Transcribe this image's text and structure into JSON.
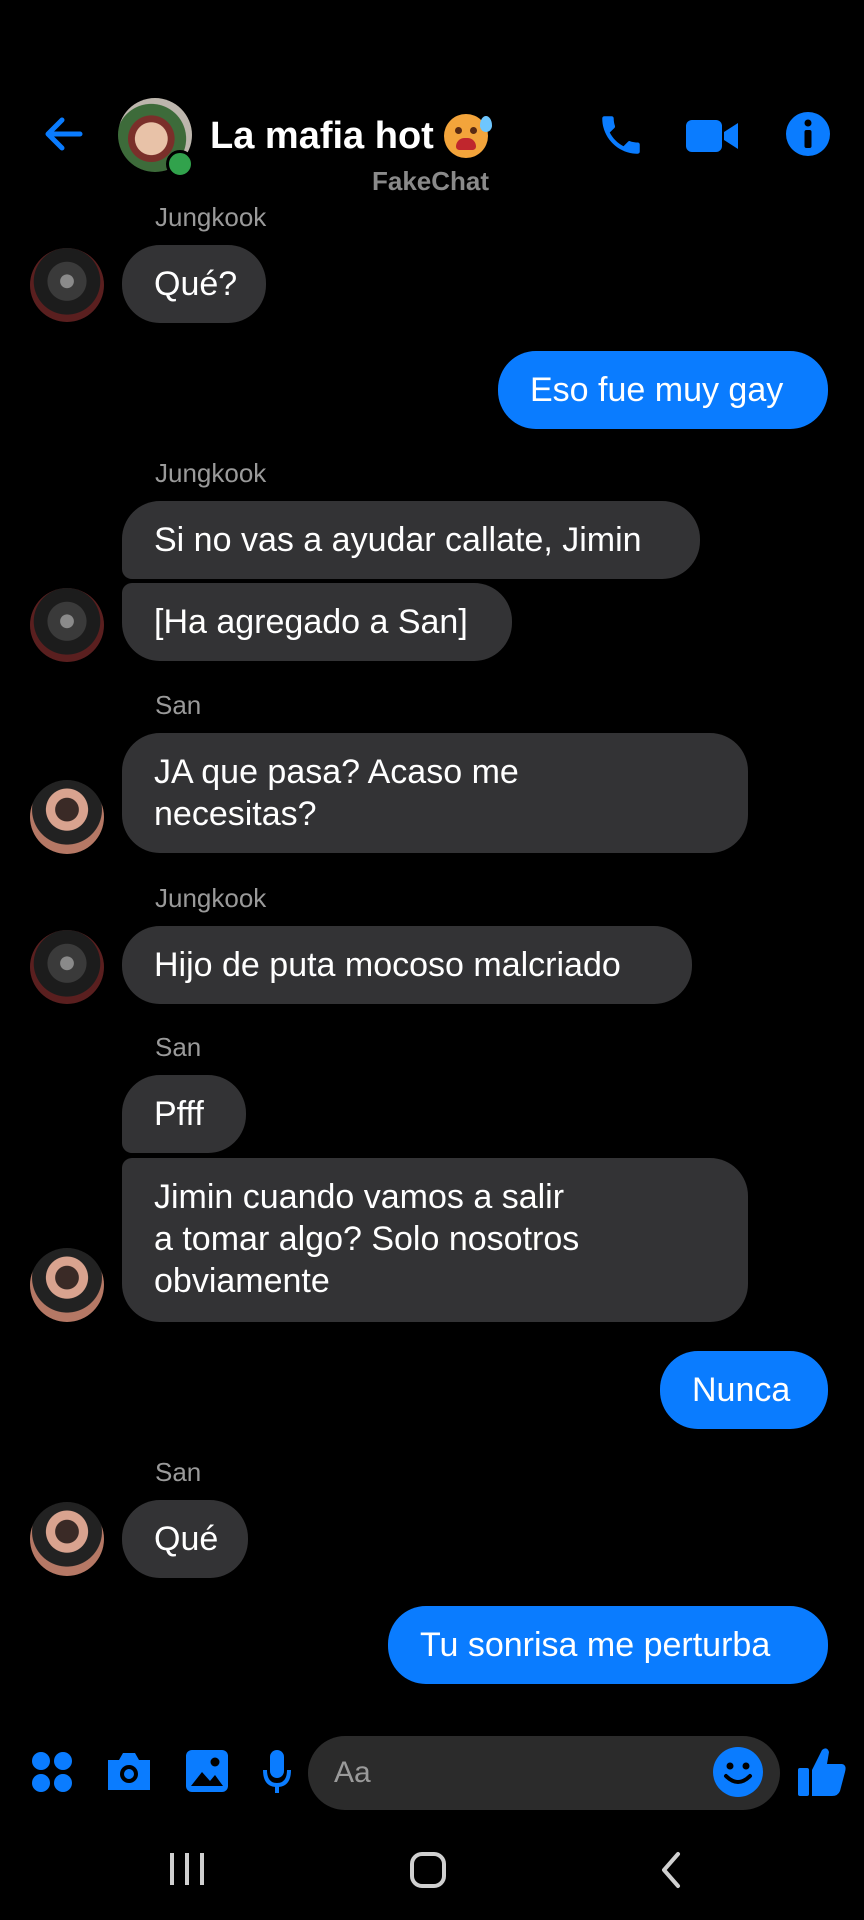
{
  "header": {
    "title": "La mafia hot",
    "watermark": "FakeChat",
    "accent": "#0a7cff",
    "icons": [
      "back-arrow-icon",
      "phone-icon",
      "video-camera-icon",
      "info-icon"
    ]
  },
  "messages": [
    {
      "sender": "Jungkook",
      "text": "Qué?"
    },
    {
      "sender": "me",
      "text": "Eso fue muy gay"
    },
    {
      "sender": "Jungkook",
      "text": "Si no vas a ayudar callate, Jimin"
    },
    {
      "sender": "Jungkook",
      "text": "[Ha agregado a San]"
    },
    {
      "sender": "San",
      "text": "JA que pasa? Acaso me\nnecesitas?"
    },
    {
      "sender": "Jungkook",
      "text": "Hijo de puta mocoso malcriado"
    },
    {
      "sender": "San",
      "text": "Pfff"
    },
    {
      "sender": "San",
      "text": "Jimin cuando vamos a salir\na tomar algo? Solo nosotros\nobviamente"
    },
    {
      "sender": "me",
      "text": "Nunca"
    },
    {
      "sender": "San",
      "text": "Qué"
    },
    {
      "sender": "me",
      "text": "Tu sonrisa me perturba"
    }
  ],
  "sender_labels": {
    "jungkook": "Jungkook",
    "san": "San"
  },
  "composer": {
    "placeholder": "Aa",
    "icons": [
      "apps-grid-icon",
      "camera-icon",
      "gallery-icon",
      "microphone-icon",
      "emoji-icon",
      "like-thumb-icon"
    ]
  },
  "colors": {
    "bubble_other": "#333335",
    "bubble_me": "#0a7cff",
    "background": "#000000"
  }
}
